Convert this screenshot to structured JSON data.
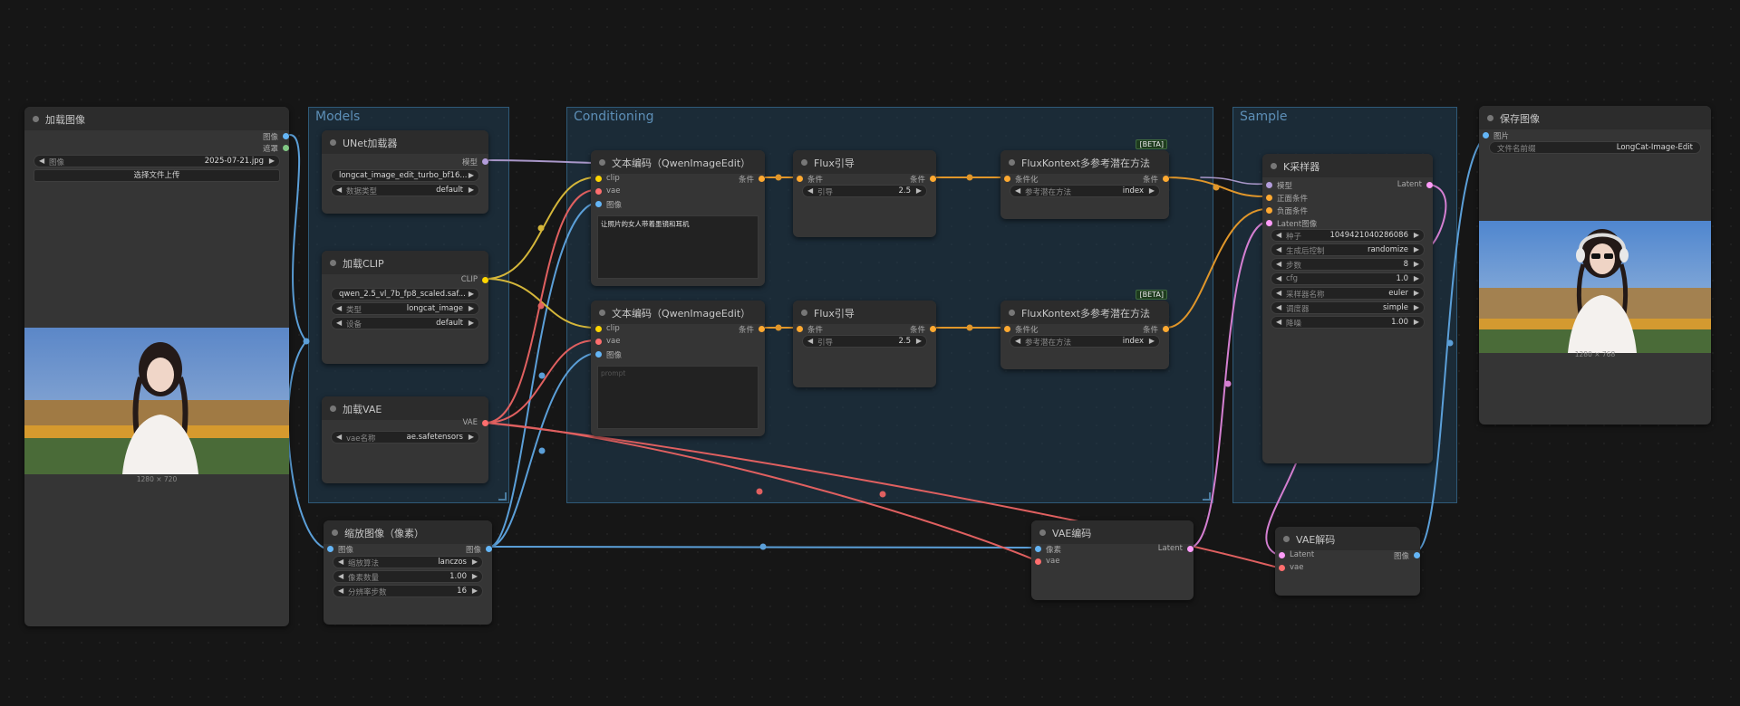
{
  "groups": {
    "models": "Models",
    "conditioning": "Conditioning",
    "sample": "Sample"
  },
  "load_image": {
    "title": "加载图像",
    "out_image": "图像",
    "out_mask": "遮罩",
    "image_label": "图像",
    "image_value": "2025-07-21.jpg",
    "upload": "选择文件上传",
    "caption": "1280 × 720"
  },
  "unet": {
    "title": "UNet加载器",
    "out_model": "模型",
    "name_value": "longcat_image_edit_turbo_bf16...",
    "dtype_label": "数据类型",
    "dtype_value": "default"
  },
  "clip": {
    "title": "加载CLIP",
    "out_clip": "CLIP",
    "name_value": "qwen_2.5_vl_7b_fp8_scaled.saf...",
    "type_label": "类型",
    "type_value": "longcat_image",
    "device_label": "设备",
    "device_value": "default"
  },
  "vae_loader": {
    "title": "加载VAE",
    "out_vae": "VAE",
    "name_label": "vae名称",
    "name_value": "ae.safetensors"
  },
  "scale": {
    "title": "缩放图像（像素）",
    "in_image": "图像",
    "out_image": "图像",
    "method_label": "缩放算法",
    "method_value": "lanczos",
    "mp_label": "像素数量",
    "mp_value": "1.00",
    "step_label": "分辨率步数",
    "step_value": "16"
  },
  "text_encode_1": {
    "title": "文本编码（QwenImageEdit）",
    "in_clip": "clip",
    "in_vae": "vae",
    "in_image": "图像",
    "out_cond": "条件",
    "prompt": "让照片的女人带着墨镜和耳机"
  },
  "text_encode_2": {
    "title": "文本编码（QwenImageEdit）",
    "in_clip": "clip",
    "in_vae": "vae",
    "in_image": "图像",
    "out_cond": "条件",
    "prompt": "prompt"
  },
  "flux_guide_1": {
    "title": "Flux引导",
    "in_cond": "条件",
    "out_cond": "条件",
    "guide_label": "引导",
    "guide_value": "2.5"
  },
  "flux_guide_2": {
    "title": "Flux引导",
    "in_cond": "条件",
    "out_cond": "条件",
    "guide_label": "引导",
    "guide_value": "2.5"
  },
  "kontext_1": {
    "title": "FluxKontext多参考潜在方法",
    "badge": "[BETA]",
    "in_cond": "条件化",
    "out_cond": "条件",
    "method_label": "参考潜在方法",
    "method_value": "index"
  },
  "kontext_2": {
    "title": "FluxKontext多参考潜在方法",
    "badge": "[BETA]",
    "in_cond": "条件化",
    "out_cond": "条件",
    "method_label": "参考潜在方法",
    "method_value": "index"
  },
  "ksampler": {
    "title": "K采样器",
    "in_model": "模型",
    "in_pos": "正面条件",
    "in_neg": "负面条件",
    "in_latent": "Latent图像",
    "out_latent": "Latent",
    "seed_label": "种子",
    "seed_value": "1049421040286086",
    "control_label": "生成后控制",
    "control_value": "randomize",
    "steps_label": "步数",
    "steps_value": "8",
    "cfg_label": "cfg",
    "cfg_value": "1.0",
    "sampler_label": "采样器名称",
    "sampler_value": "euler",
    "scheduler_label": "调度器",
    "scheduler_value": "simple",
    "denoise_label": "降噪",
    "denoise_value": "1.00"
  },
  "save_image": {
    "title": "保存图像",
    "in_images": "图片",
    "prefix_label": "文件名前缀",
    "prefix_value": "LongCat-Image-Edit",
    "caption": "1280 × 768"
  },
  "vae_encode": {
    "title": "VAE编码",
    "in_pixels": "像素",
    "in_vae": "vae",
    "out_latent": "Latent"
  },
  "vae_decode": {
    "title": "VAE解码",
    "in_latent": "Latent",
    "in_vae": "vae",
    "out_image": "图像"
  },
  "colors": {
    "image": "#64b5f6",
    "clip": "#ffd500",
    "vae": "#ff6e6e",
    "conditioning": "#ffa931",
    "model": "#b39ddb",
    "latent": "#ff9cf9",
    "mask": "#81c784"
  },
  "arrows": {
    "left": "◀",
    "right": "▶"
  }
}
